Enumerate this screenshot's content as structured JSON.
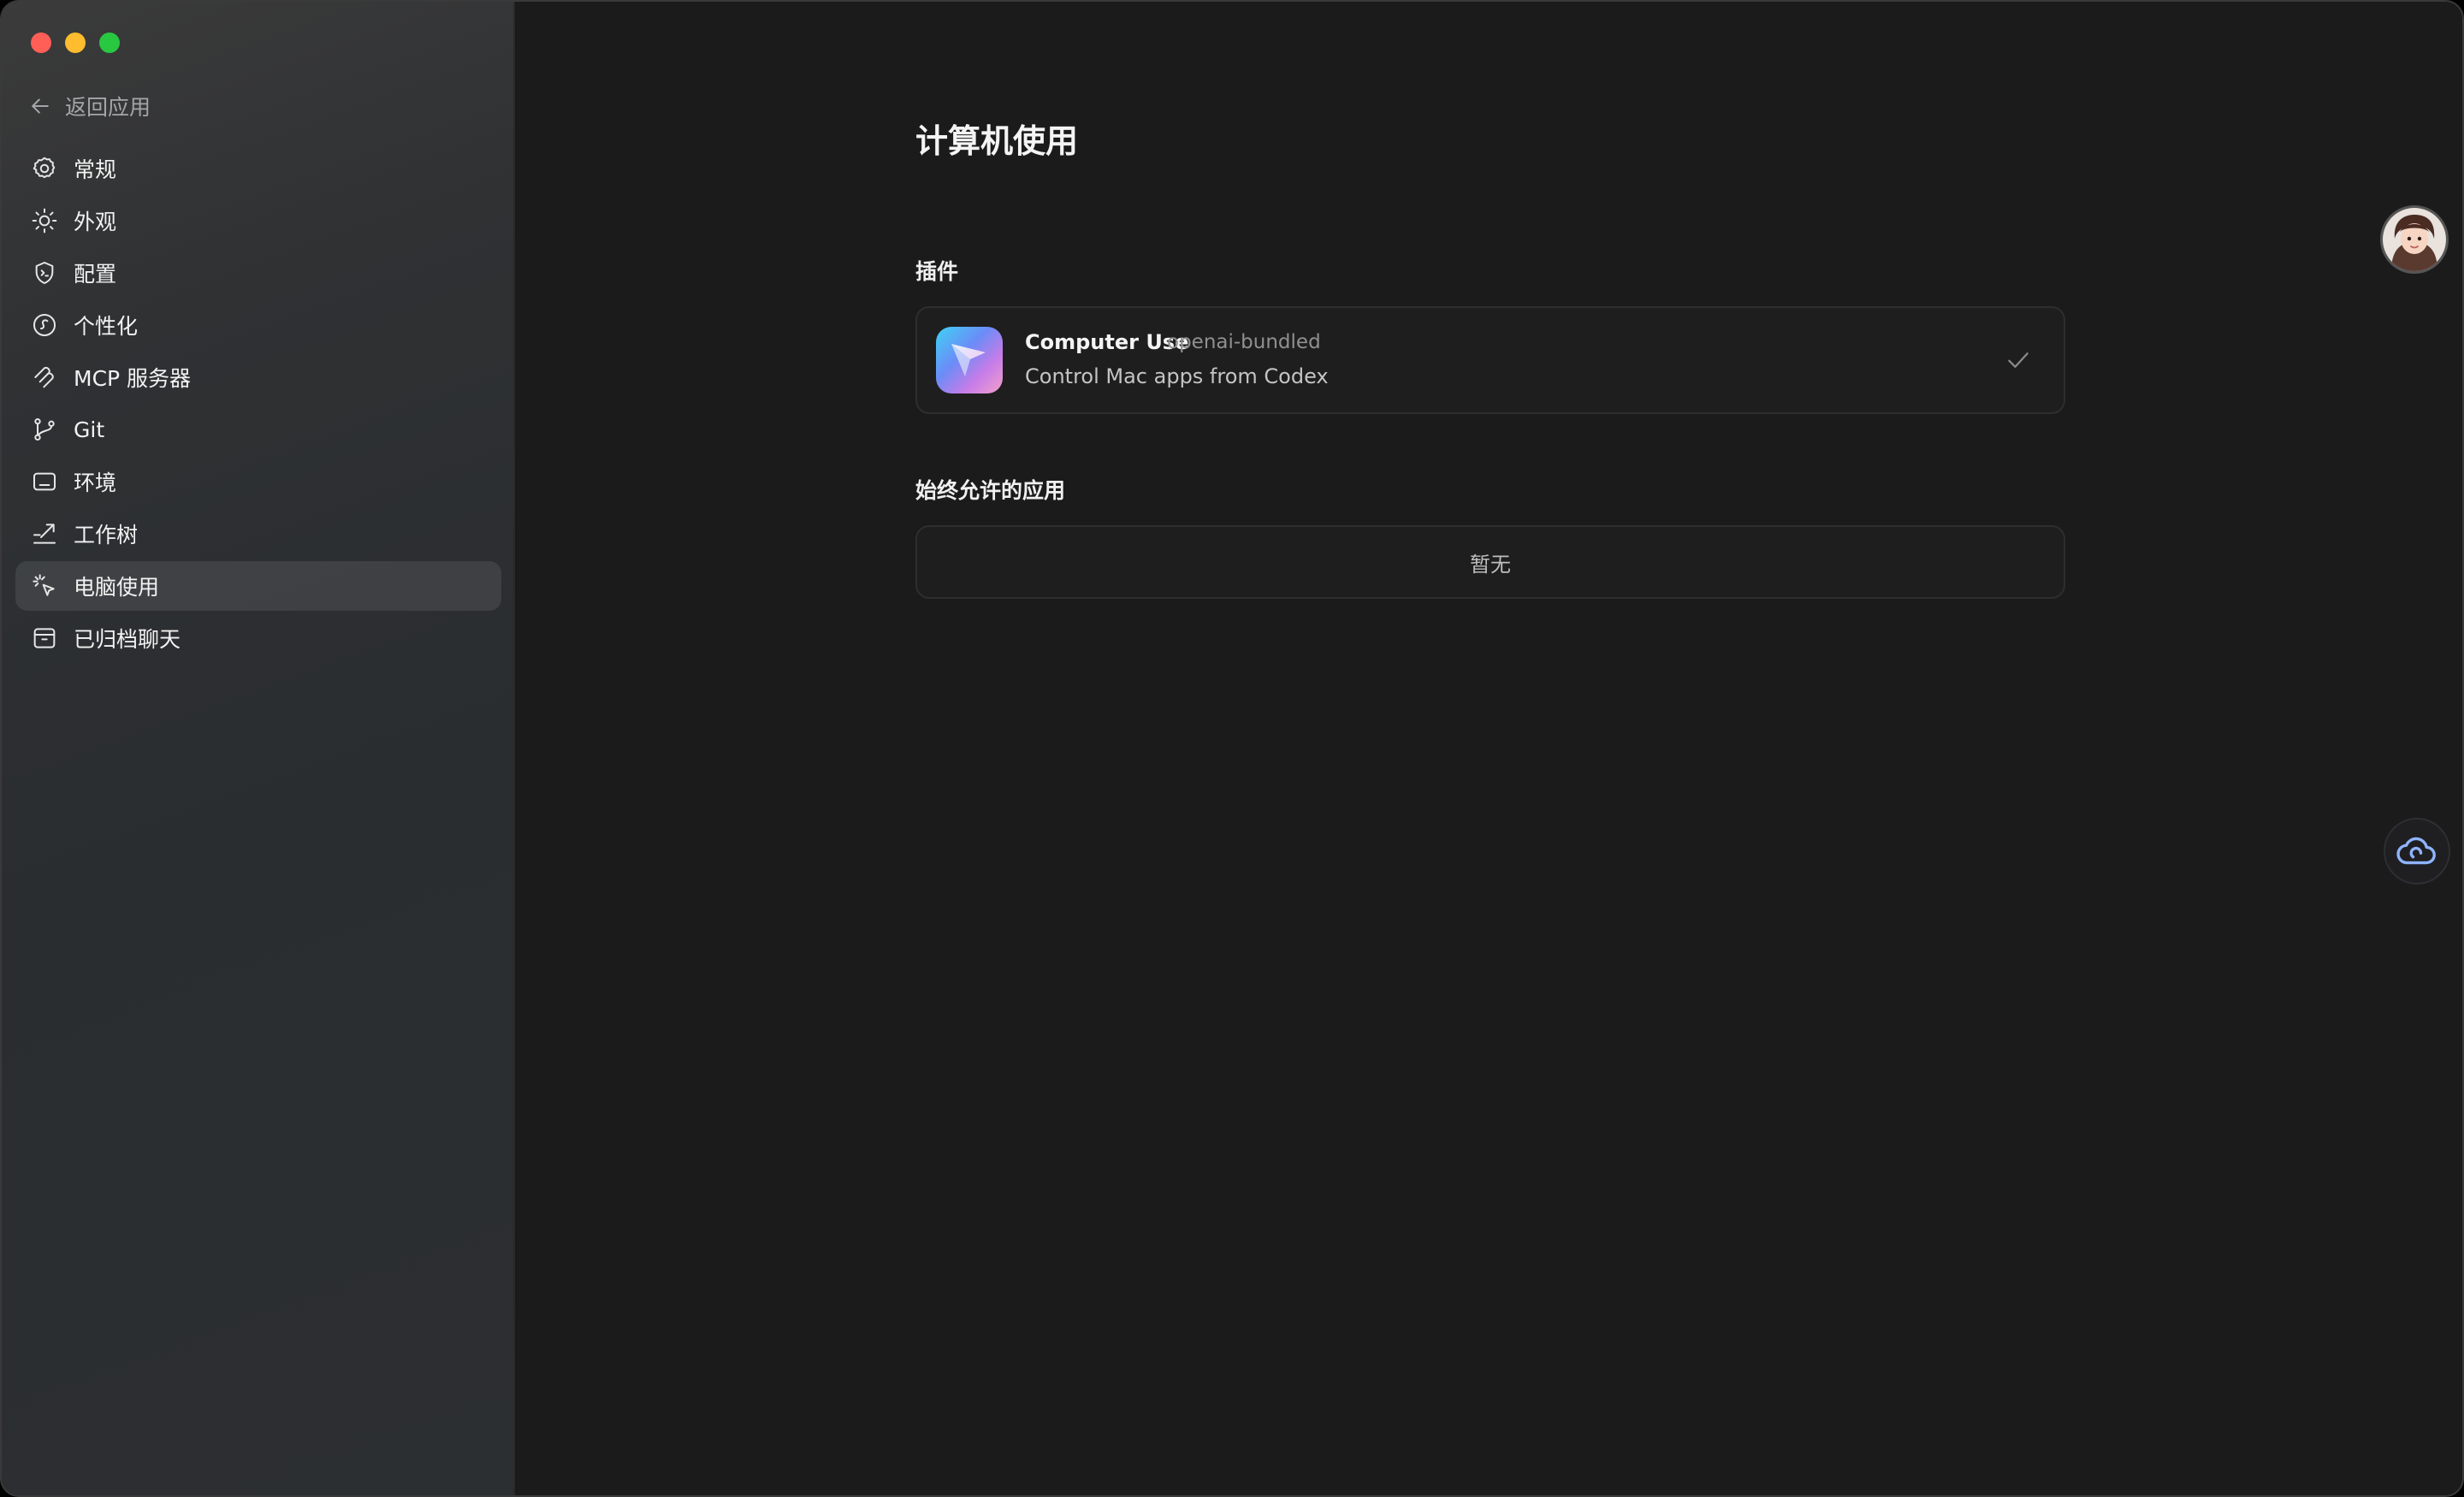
{
  "window": {
    "traffic_lights": [
      "close",
      "minimize",
      "zoom"
    ]
  },
  "sidebar": {
    "back_label": "返回应用",
    "items": [
      {
        "label": "常规",
        "icon": "gear-icon"
      },
      {
        "label": "外观",
        "icon": "sun-icon"
      },
      {
        "label": "配置",
        "icon": "config-shield-icon"
      },
      {
        "label": "个性化",
        "icon": "personalize-icon"
      },
      {
        "label": "MCP 服务器",
        "icon": "mcp-icon"
      },
      {
        "label": "Git",
        "icon": "git-branch-icon"
      },
      {
        "label": "环境",
        "icon": "monitor-icon"
      },
      {
        "label": "工作树",
        "icon": "worktree-icon"
      },
      {
        "label": "电脑使用",
        "icon": "cursor-click-icon",
        "active": true
      },
      {
        "label": "已归档聊天",
        "icon": "archive-icon"
      }
    ]
  },
  "main": {
    "title": "计算机使用",
    "plugins_section": "插件",
    "plugin": {
      "name": "Computer Use",
      "source": "openai-bundled",
      "description": "Control Mac apps from Codex",
      "enabled": true
    },
    "allowed_apps_section": "始终允许的应用",
    "allowed_apps_empty": "暂无"
  },
  "colors": {
    "sidebar_bg": "#2c2f31",
    "main_bg": "#1b1b1b",
    "active_item_bg": "#3a3d40",
    "accent_cloud": "#8fb4ff"
  }
}
